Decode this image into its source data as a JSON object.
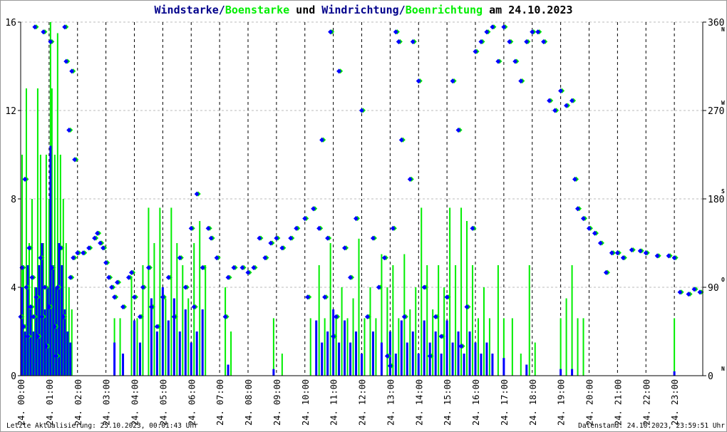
{
  "title": {
    "part1": "Windstarke/",
    "part2": "Boenstarke",
    "part3": " und ",
    "part4": "Windrichtung/",
    "part5": "Boenrichtung",
    "part6": " am 24.10.2023"
  },
  "footer": {
    "left": "Letzte Aktualisierung: 25.10.2023, 00:01:43 Uhr",
    "right": "Datenstand: 24.10.2023, 23:59:51 Uhr"
  },
  "colors": {
    "wind": "#0000ff",
    "gust": "#00ee00",
    "title_dark": "#00008b",
    "grid": "#000000"
  },
  "chart_data": {
    "type": "bar+scatter",
    "title": "Windstarke/Boenstarke und Windrichtung/Boenrichtung am 24.10.2023",
    "ylim_left": [
      0,
      16
    ],
    "yticks_left": [
      "0",
      "4",
      "8",
      "12",
      "16"
    ],
    "ylim_right": [
      0,
      360
    ],
    "yticks_right": [
      "0",
      "90",
      "180",
      "270",
      "360"
    ],
    "compass_right": [
      "N",
      "O",
      "S",
      "W",
      "N"
    ],
    "xlim": [
      0,
      24
    ],
    "xticks": [
      "24. 00:00",
      "24. 01:00",
      "24. 02:00",
      "24. 03:00",
      "24. 04:00",
      "24. 05:00",
      "24. 06:00",
      "24. 07:00",
      "24. 08:00",
      "24. 09:00",
      "24. 10:00",
      "24. 11:00",
      "24. 12:00",
      "24. 13:00",
      "24. 14:00",
      "24. 15:00",
      "24. 16:00",
      "24. 17:00",
      "24. 18:00",
      "24. 19:00",
      "24. 20:00",
      "24. 21:00",
      "24. 22:00",
      "24. 23:00"
    ],
    "gust_speed": [
      [
        0.05,
        10
      ],
      [
        0.1,
        5
      ],
      [
        0.2,
        13
      ],
      [
        0.3,
        6
      ],
      [
        0.4,
        8
      ],
      [
        0.5,
        4
      ],
      [
        0.6,
        13
      ],
      [
        0.7,
        10
      ],
      [
        0.8,
        6
      ],
      [
        0.9,
        10
      ],
      [
        1.0,
        8
      ],
      [
        1.05,
        16
      ],
      [
        1.1,
        13
      ],
      [
        1.2,
        10
      ],
      [
        1.3,
        15.5
      ],
      [
        1.4,
        10
      ],
      [
        1.5,
        8
      ],
      [
        1.6,
        6
      ],
      [
        1.7,
        4
      ],
      [
        1.8,
        3
      ],
      [
        3.3,
        2.6
      ],
      [
        3.5,
        2.6
      ],
      [
        3.9,
        4.5
      ],
      [
        4.1,
        2.6
      ],
      [
        4.3,
        5
      ],
      [
        4.5,
        7.6
      ],
      [
        4.7,
        6
      ],
      [
        4.9,
        7.6
      ],
      [
        5.1,
        3.5
      ],
      [
        5.3,
        7.6
      ],
      [
        5.5,
        6
      ],
      [
        5.7,
        5
      ],
      [
        5.9,
        3.5
      ],
      [
        6.1,
        6
      ],
      [
        6.3,
        7
      ],
      [
        6.5,
        5
      ],
      [
        7.2,
        4
      ],
      [
        7.4,
        2
      ],
      [
        8.9,
        2.6
      ],
      [
        9.2,
        1
      ],
      [
        10.2,
        2.6
      ],
      [
        10.5,
        5
      ],
      [
        10.7,
        2.6
      ],
      [
        10.9,
        6
      ],
      [
        11.1,
        2.6
      ],
      [
        11.3,
        4
      ],
      [
        11.5,
        2.6
      ],
      [
        11.7,
        3.5
      ],
      [
        11.9,
        6.2
      ],
      [
        12.1,
        2.6
      ],
      [
        12.3,
        4
      ],
      [
        12.5,
        2.6
      ],
      [
        12.7,
        5.5
      ],
      [
        12.9,
        4
      ],
      [
        13.1,
        5
      ],
      [
        13.3,
        2.6
      ],
      [
        13.5,
        5.5
      ],
      [
        13.7,
        3
      ],
      [
        13.9,
        4
      ],
      [
        14.1,
        7.6
      ],
      [
        14.3,
        5
      ],
      [
        14.5,
        3
      ],
      [
        14.7,
        5
      ],
      [
        14.9,
        4
      ],
      [
        15.1,
        7.6
      ],
      [
        15.3,
        5
      ],
      [
        15.5,
        7.6
      ],
      [
        15.7,
        7
      ],
      [
        15.9,
        5
      ],
      [
        16.1,
        2.6
      ],
      [
        16.3,
        4
      ],
      [
        16.5,
        2.6
      ],
      [
        16.8,
        5
      ],
      [
        17.0,
        2.6
      ],
      [
        17.3,
        2.6
      ],
      [
        17.6,
        1
      ],
      [
        17.9,
        5
      ],
      [
        18.1,
        1.5
      ],
      [
        19.0,
        2.6
      ],
      [
        19.2,
        3.5
      ],
      [
        19.4,
        5
      ],
      [
        19.6,
        2.6
      ],
      [
        19.8,
        2.6
      ],
      [
        23.0,
        2.6
      ]
    ],
    "mean_speed": [
      [
        0.05,
        4
      ],
      [
        0.15,
        2
      ],
      [
        0.25,
        5
      ],
      [
        0.35,
        3
      ],
      [
        0.45,
        2
      ],
      [
        0.55,
        4
      ],
      [
        0.65,
        5
      ],
      [
        0.75,
        6
      ],
      [
        0.85,
        3
      ],
      [
        0.95,
        4
      ],
      [
        1.05,
        10.4
      ],
      [
        1.15,
        5
      ],
      [
        1.25,
        4
      ],
      [
        1.35,
        6
      ],
      [
        1.45,
        5
      ],
      [
        1.55,
        3
      ],
      [
        1.65,
        2
      ],
      [
        1.75,
        1.5
      ],
      [
        3.3,
        1.5
      ],
      [
        3.6,
        1
      ],
      [
        4.0,
        2.5
      ],
      [
        4.2,
        1.5
      ],
      [
        4.6,
        3.5
      ],
      [
        4.8,
        2
      ],
      [
        5.0,
        4
      ],
      [
        5.2,
        2.5
      ],
      [
        5.4,
        3.5
      ],
      [
        5.6,
        2
      ],
      [
        5.8,
        3
      ],
      [
        6.0,
        1.5
      ],
      [
        6.2,
        2
      ],
      [
        6.4,
        3
      ],
      [
        7.3,
        0.5
      ],
      [
        8.9,
        0.3
      ],
      [
        10.4,
        2.5
      ],
      [
        10.6,
        1.5
      ],
      [
        10.8,
        2
      ],
      [
        11.0,
        3
      ],
      [
        11.2,
        1.5
      ],
      [
        11.4,
        2.5
      ],
      [
        11.6,
        1.5
      ],
      [
        11.8,
        2
      ],
      [
        12.0,
        1
      ],
      [
        12.4,
        2
      ],
      [
        12.7,
        1.5
      ],
      [
        13.0,
        2
      ],
      [
        13.2,
        1
      ],
      [
        13.4,
        2.5
      ],
      [
        13.6,
        1.5
      ],
      [
        13.8,
        2
      ],
      [
        14.0,
        1
      ],
      [
        14.2,
        2.5
      ],
      [
        14.4,
        1.5
      ],
      [
        14.6,
        2
      ],
      [
        14.8,
        1
      ],
      [
        15.0,
        2.5
      ],
      [
        15.2,
        1.5
      ],
      [
        15.4,
        2
      ],
      [
        15.6,
        1
      ],
      [
        15.8,
        2
      ],
      [
        16.0,
        1.5
      ],
      [
        16.2,
        1
      ],
      [
        16.4,
        1.5
      ],
      [
        16.6,
        1
      ],
      [
        17.0,
        0.8
      ],
      [
        17.8,
        0.5
      ],
      [
        19.0,
        0.3
      ],
      [
        19.4,
        0.3
      ],
      [
        23.0,
        0.2
      ]
    ],
    "wind_direction": [
      [
        0.0,
        60
      ],
      [
        0.05,
        110
      ],
      [
        0.1,
        50
      ],
      [
        0.15,
        200
      ],
      [
        0.2,
        90
      ],
      [
        0.25,
        40
      ],
      [
        0.3,
        130
      ],
      [
        0.35,
        70
      ],
      [
        0.4,
        100
      ],
      [
        0.45,
        60
      ],
      [
        0.5,
        355
      ],
      [
        0.55,
        80
      ],
      [
        0.6,
        40
      ],
      [
        0.7,
        120
      ],
      [
        0.75,
        60
      ],
      [
        0.8,
        350
      ],
      [
        0.85,
        90
      ],
      [
        0.9,
        30
      ],
      [
        1.0,
        70
      ],
      [
        1.05,
        340
      ],
      [
        1.1,
        110
      ],
      [
        1.2,
        50
      ],
      [
        1.25,
        20
      ],
      [
        1.3,
        90
      ],
      [
        1.4,
        130
      ],
      [
        1.5,
        60
      ],
      [
        1.55,
        355
      ],
      [
        1.6,
        320
      ],
      [
        1.7,
        250
      ],
      [
        1.75,
        100
      ],
      [
        1.8,
        310
      ],
      [
        1.85,
        120
      ],
      [
        1.9,
        220
      ],
      [
        2.0,
        125
      ],
      [
        2.2,
        125
      ],
      [
        2.4,
        130
      ],
      [
        2.6,
        140
      ],
      [
        2.7,
        145
      ],
      [
        2.8,
        135
      ],
      [
        2.9,
        130
      ],
      [
        3.0,
        115
      ],
      [
        3.1,
        100
      ],
      [
        3.2,
        90
      ],
      [
        3.3,
        80
      ],
      [
        3.4,
        95
      ],
      [
        3.6,
        70
      ],
      [
        3.8,
        100
      ],
      [
        3.9,
        105
      ],
      [
        4.0,
        80
      ],
      [
        4.2,
        60
      ],
      [
        4.3,
        90
      ],
      [
        4.5,
        110
      ],
      [
        4.6,
        70
      ],
      [
        4.8,
        50
      ],
      [
        5.0,
        80
      ],
      [
        5.2,
        100
      ],
      [
        5.4,
        60
      ],
      [
        5.6,
        120
      ],
      [
        5.8,
        90
      ],
      [
        6.0,
        150
      ],
      [
        6.1,
        70
      ],
      [
        6.2,
        185
      ],
      [
        6.4,
        110
      ],
      [
        6.6,
        150
      ],
      [
        6.7,
        140
      ],
      [
        6.9,
        120
      ],
      [
        7.2,
        60
      ],
      [
        7.3,
        100
      ],
      [
        7.5,
        110
      ],
      [
        7.8,
        110
      ],
      [
        8.0,
        105
      ],
      [
        8.2,
        110
      ],
      [
        8.4,
        140
      ],
      [
        8.6,
        120
      ],
      [
        8.8,
        135
      ],
      [
        9.0,
        140
      ],
      [
        9.2,
        130
      ],
      [
        9.5,
        140
      ],
      [
        9.7,
        150
      ],
      [
        10.0,
        160
      ],
      [
        10.1,
        80
      ],
      [
        10.3,
        170
      ],
      [
        10.5,
        150
      ],
      [
        10.6,
        240
      ],
      [
        10.7,
        80
      ],
      [
        10.8,
        140
      ],
      [
        10.9,
        350
      ],
      [
        11.0,
        40
      ],
      [
        11.1,
        60
      ],
      [
        11.2,
        310
      ],
      [
        11.4,
        130
      ],
      [
        11.6,
        100
      ],
      [
        11.8,
        160
      ],
      [
        12.0,
        270
      ],
      [
        12.2,
        60
      ],
      [
        12.4,
        140
      ],
      [
        12.6,
        90
      ],
      [
        12.8,
        120
      ],
      [
        12.9,
        20
      ],
      [
        13.0,
        10
      ],
      [
        13.1,
        150
      ],
      [
        13.2,
        350
      ],
      [
        13.3,
        340
      ],
      [
        13.4,
        240
      ],
      [
        13.5,
        60
      ],
      [
        13.7,
        200
      ],
      [
        13.8,
        340
      ],
      [
        14.0,
        300
      ],
      [
        14.2,
        90
      ],
      [
        14.4,
        20
      ],
      [
        14.6,
        60
      ],
      [
        14.8,
        40
      ],
      [
        15.0,
        80
      ],
      [
        15.2,
        300
      ],
      [
        15.4,
        250
      ],
      [
        15.5,
        30
      ],
      [
        15.7,
        70
      ],
      [
        15.9,
        150
      ],
      [
        16.0,
        330
      ],
      [
        16.2,
        340
      ],
      [
        16.4,
        350
      ],
      [
        16.6,
        355
      ],
      [
        16.8,
        320
      ],
      [
        17.0,
        355
      ],
      [
        17.2,
        340
      ],
      [
        17.4,
        320
      ],
      [
        17.6,
        300
      ],
      [
        17.8,
        340
      ],
      [
        18.0,
        350
      ],
      [
        18.2,
        350
      ],
      [
        18.4,
        340
      ],
      [
        18.6,
        280
      ],
      [
        18.8,
        270
      ],
      [
        19.0,
        290
      ],
      [
        19.2,
        275
      ],
      [
        19.4,
        280
      ],
      [
        19.5,
        200
      ],
      [
        19.6,
        170
      ],
      [
        19.8,
        160
      ],
      [
        20.0,
        150
      ],
      [
        20.2,
        145
      ],
      [
        20.4,
        135
      ],
      [
        20.6,
        105
      ],
      [
        20.8,
        125
      ],
      [
        21.0,
        125
      ],
      [
        21.2,
        120
      ],
      [
        21.5,
        128
      ],
      [
        21.8,
        127
      ],
      [
        22.0,
        125
      ],
      [
        22.4,
        122
      ],
      [
        22.8,
        122
      ],
      [
        23.0,
        120
      ],
      [
        23.2,
        85
      ],
      [
        23.5,
        83
      ],
      [
        23.7,
        88
      ],
      [
        23.9,
        85
      ]
    ]
  }
}
